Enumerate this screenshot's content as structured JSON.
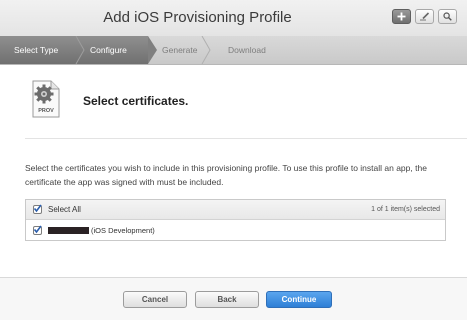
{
  "header": {
    "title": "Add iOS Provisioning Profile",
    "tools": [
      {
        "icon": "plus-icon"
      },
      {
        "icon": "edit-icon"
      },
      {
        "icon": "search-icon"
      }
    ]
  },
  "steps": {
    "items": [
      {
        "label": "Select Type",
        "state": "done"
      },
      {
        "label": "Configure",
        "state": "current"
      },
      {
        "label": "Generate",
        "state": "upcoming"
      },
      {
        "label": "Download",
        "state": "upcoming"
      }
    ]
  },
  "main": {
    "icon_label": "PROV",
    "heading": "Select certificates.",
    "description": "Select the certificates you wish to include in this provisioning profile. To use this profile to install an app, the certificate the app was signed with must be included.",
    "table": {
      "select_all_label": "Select All",
      "select_all_checked": true,
      "count_text": "1 of 1 item(s) selected",
      "rows": [
        {
          "checked": true,
          "cert_type": "(iOS Development)"
        }
      ]
    }
  },
  "footer": {
    "cancel_label": "Cancel",
    "back_label": "Back",
    "continue_label": "Continue"
  },
  "colors": {
    "accent": "#2e7fd6",
    "step_active": "#808080"
  }
}
